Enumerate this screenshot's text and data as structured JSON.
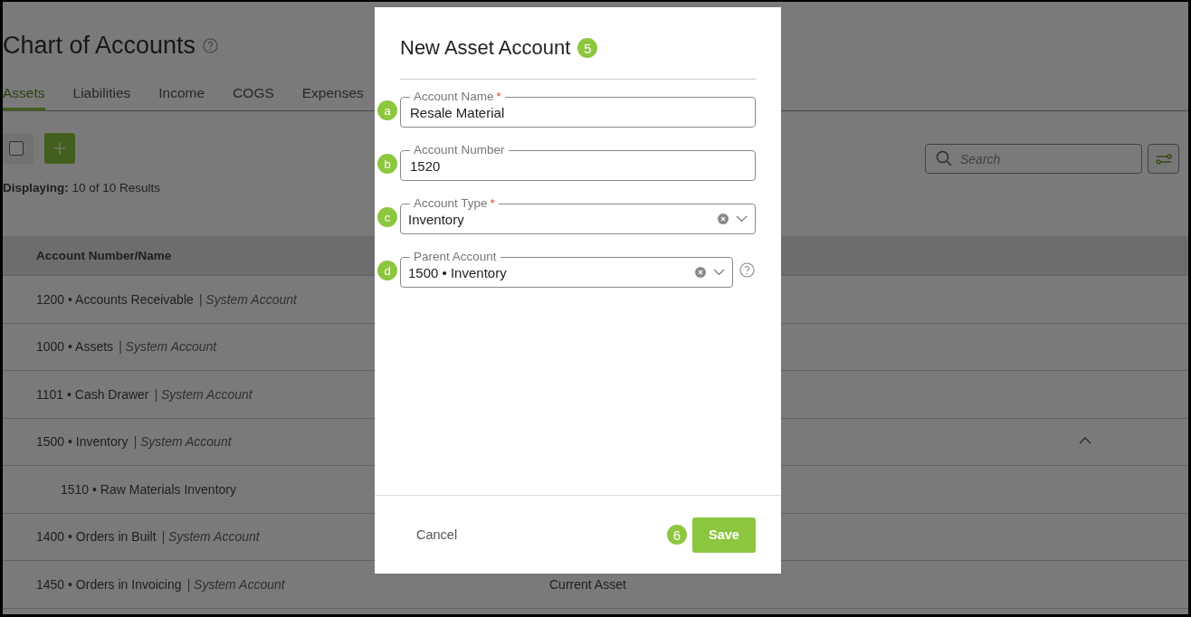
{
  "page": {
    "title": "Chart of Accounts",
    "tabs": [
      {
        "label": "Assets",
        "selected": true
      },
      {
        "label": "Liabilities",
        "selected": false
      },
      {
        "label": "Income",
        "selected": false
      },
      {
        "label": "COGS",
        "selected": false
      },
      {
        "label": "Expenses",
        "selected": false
      }
    ],
    "select_all": {
      "checked": false
    },
    "displaying": {
      "label": "Displaying:",
      "value": "10 of 10 Results"
    },
    "search": {
      "placeholder": "Search"
    },
    "table": {
      "columns": [
        "Account Number/Name"
      ],
      "rows": [
        {
          "name": "1200 • Accounts Receivable",
          "tag": "| System Account"
        },
        {
          "name": "1000 • Assets",
          "tag": "| System Account"
        },
        {
          "name": "1101 • Cash Drawer",
          "tag": "| System Account"
        },
        {
          "name": "1500 • Inventory",
          "tag": "| System Account",
          "expanded": true,
          "children": [
            {
              "name": "1510 • Raw Materials Inventory"
            }
          ]
        },
        {
          "name": "1400 • Orders in Built",
          "tag": "| System Account"
        },
        {
          "name": "1450 • Orders in Invoicing",
          "tag": "| System Account",
          "column_2": "Current Asset"
        }
      ]
    }
  },
  "dialog": {
    "title": "New Asset Account",
    "step": "5",
    "fields": [
      {
        "marker": "a",
        "kind": "text",
        "label": "Account Name",
        "required_mark": "*",
        "value": "Resale Material",
        "help": false
      },
      {
        "marker": "b",
        "kind": "text",
        "label": "Account Number",
        "value": "1520",
        "help": false
      },
      {
        "marker": "c",
        "kind": "select",
        "label": "Account Type",
        "required_mark": "*",
        "value": "Inventory",
        "help": false
      },
      {
        "marker": "d",
        "kind": "select",
        "label": "Parent Account",
        "value": "1500 • Inventory",
        "help": true
      }
    ],
    "cancel": "Cancel",
    "save_step": "6",
    "save": "Save"
  }
}
